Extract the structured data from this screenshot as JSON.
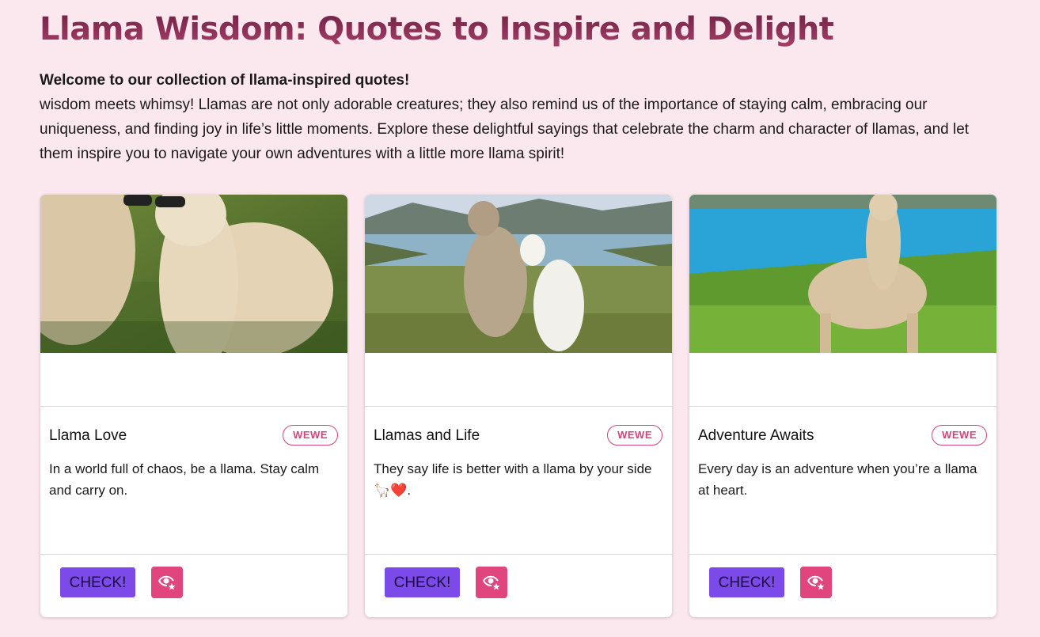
{
  "header": {
    "title": "Llama Wisdom: Quotes to Inspire and Delight",
    "lead": "Welcome to our collection of llama-inspired quotes!",
    "body": "wisdom meets whimsy! Llamas are not only adorable creatures; they also remind us of the importance of staying calm, embracing our uniqueness, and finding joy in life’s little moments. Explore these delightful sayings that celebrate the charm and character of llamas, and let them inspire you to navigate your own adventures with a little more llama spirit!"
  },
  "cards": [
    {
      "title": "Llama Love",
      "badge": "WEWE",
      "text": "In a world full of chaos, be a llama. Stay calm and carry on.",
      "check_label": "CHECK!",
      "view_icon": "eye-star-icon",
      "image": "alpacas-with-sunglasses-photo"
    },
    {
      "title": "Llamas and Life",
      "badge": "WEWE",
      "text": "They say life is better with a llama by your side 🦙❤️.",
      "check_label": "CHECK!",
      "view_icon": "eye-star-icon",
      "image": "two-alpacas-by-lake-photo"
    },
    {
      "title": "Adventure Awaits",
      "badge": "WEWE",
      "text": "Every day is an adventure when you’re a llama at heart.",
      "check_label": "CHECK!",
      "view_icon": "eye-star-icon",
      "image": "alpaca-by-blue-lake-photo"
    }
  ],
  "colors": {
    "background": "#fbe7ee",
    "title": "#8c2e55",
    "check_button": "#7b4ae8",
    "view_button": "#e0457e",
    "badge": "#d0457b"
  }
}
